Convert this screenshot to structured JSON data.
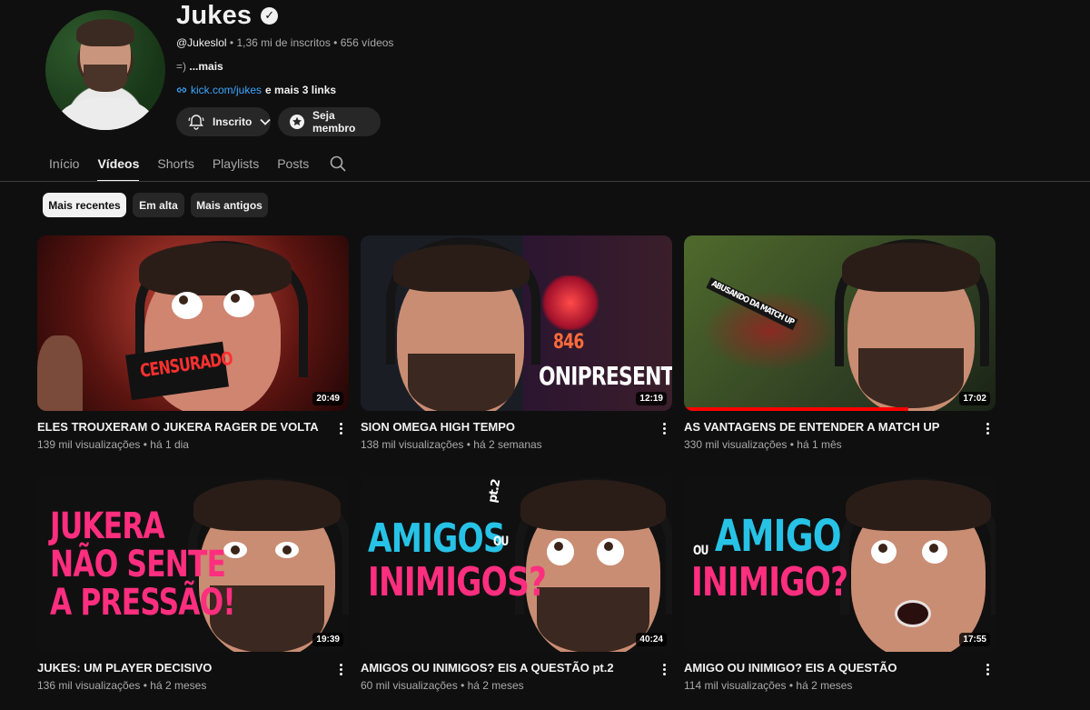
{
  "channel": {
    "name": "Jukes",
    "handle": "@Jukeslol",
    "separator": "•",
    "subscribers": "1,36 mi de inscritos",
    "videos_count": "656 vídeos",
    "description": "=)",
    "description_more": "...mais",
    "link": "kick.com/jukes",
    "more_links": "e mais 3 links",
    "verified": true
  },
  "buttons": {
    "subscribed": "Inscrito",
    "member": "Seja membro"
  },
  "tabs": [
    {
      "label": "Início",
      "active": false
    },
    {
      "label": "Vídeos",
      "active": true
    },
    {
      "label": "Shorts",
      "active": false
    },
    {
      "label": "Playlists",
      "active": false
    },
    {
      "label": "Posts",
      "active": false
    }
  ],
  "chips": [
    {
      "label": "Mais recentes",
      "active": true
    },
    {
      "label": "Em alta",
      "active": false
    },
    {
      "label": "Mais antigos",
      "active": false
    }
  ],
  "videos": [
    {
      "title": "ELES TROUXERAM O JUKERA RAGER DE VOLTA",
      "views": "139 mil visualizações",
      "age": "há 1 dia",
      "duration": "20:49",
      "thumb_text": "CENSURADO",
      "watched": 0
    },
    {
      "title": "SION OMEGA HIGH TEMPO",
      "views": "138 mil visualizações",
      "age": "há 2 semanas",
      "duration": "12:19",
      "thumb_text": "ONIPRESENTE",
      "thumb_number": "846",
      "watched": 0
    },
    {
      "title": "AS VANTAGENS DE ENTENDER A MATCH UP",
      "views": "330 mil visualizações",
      "age": "há 1 mês",
      "duration": "17:02",
      "thumb_text": "ABUSANDO DA MATCH UP",
      "watched": 0.72
    },
    {
      "title": "JUKES: UM PLAYER DECISIVO",
      "views": "136 mil visualizações",
      "age": "há 2 meses",
      "duration": "19:39",
      "thumb_lines": [
        "JUKERA",
        "NÃO SENTE",
        "A PRESSÃO!"
      ],
      "watched": 0
    },
    {
      "title": "AMIGOS OU INIMIGOS? EIS A QUESTÃO pt.2",
      "views": "60 mil visualizações",
      "age": "há 2 meses",
      "duration": "40:24",
      "thumb_lines": [
        "AMIGOS",
        "OU",
        "INIMIGOS?"
      ],
      "thumb_tag": "pt.2",
      "watched": 0
    },
    {
      "title": "AMIGO OU INIMIGO? EIS A QUESTÃO",
      "views": "114 mil visualizações",
      "age": "há 2 meses",
      "duration": "17:55",
      "thumb_lines": [
        "OU",
        "AMIGO",
        "INIMIGO?"
      ],
      "watched": 0
    }
  ],
  "colors": {
    "background": "#0f0f0f",
    "surface": "#272727",
    "link": "#3ea6ff",
    "progress": "#ff0000",
    "pink": "#ff2e7e",
    "cyan": "#27c3e6"
  }
}
